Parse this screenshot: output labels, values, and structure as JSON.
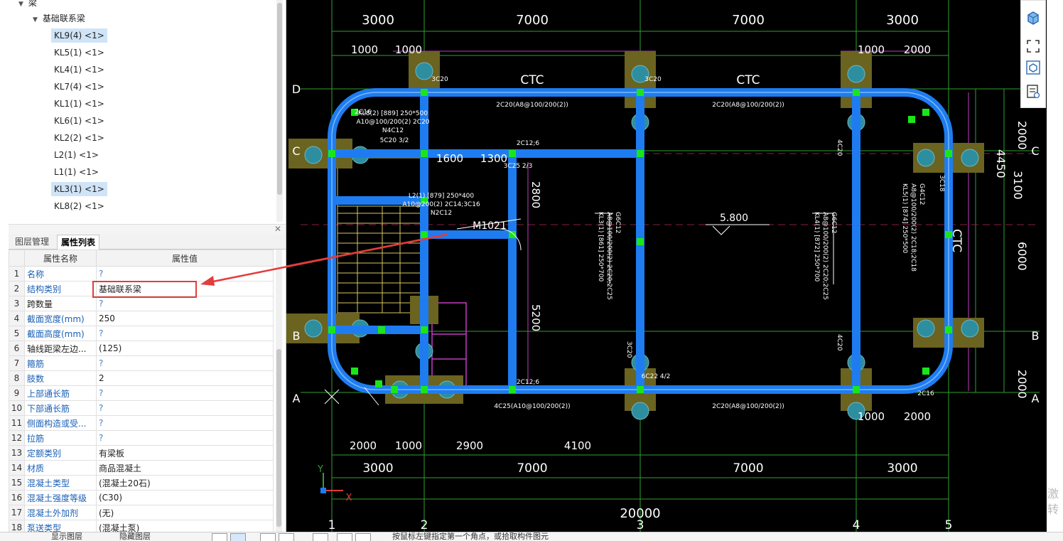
{
  "tree": {
    "root_label": "梁",
    "group_label": "基础联系梁",
    "items": [
      {
        "label": "KL9(4)",
        "count": "<1>",
        "selected": true
      },
      {
        "label": "KL5(1)",
        "count": "<1>"
      },
      {
        "label": "KL4(1)",
        "count": "<1>"
      },
      {
        "label": "KL7(4)",
        "count": "<1>"
      },
      {
        "label": "KL1(1)",
        "count": "<1>"
      },
      {
        "label": "KL6(1)",
        "count": "<1>"
      },
      {
        "label": "KL2(2)",
        "count": "<1>"
      },
      {
        "label": "L2(1)",
        "count": "<1>"
      },
      {
        "label": "L1(1)",
        "count": "<1>"
      },
      {
        "label": "KL3(1)",
        "count": "<1>",
        "selected": true
      },
      {
        "label": "KL8(2)",
        "count": "<1>"
      }
    ]
  },
  "tabs": [
    {
      "label": "图层管理"
    },
    {
      "label": "属性列表",
      "active": true
    }
  ],
  "props": {
    "header_name": "属性名称",
    "header_value": "属性值",
    "rows": [
      {
        "num": "1",
        "name": "名称",
        "value": "?",
        "blue": true
      },
      {
        "num": "2",
        "name": "结构类别",
        "value": "基础联系梁",
        "blue": true
      },
      {
        "num": "3",
        "name": "跨数量",
        "value": "?",
        "blue": false
      },
      {
        "num": "4",
        "name": "截面宽度(mm)",
        "value": "250",
        "blue": true
      },
      {
        "num": "5",
        "name": "截面高度(mm)",
        "value": "?",
        "blue": true
      },
      {
        "num": "6",
        "name": "轴线距梁左边...",
        "value": "(125)",
        "blue": false
      },
      {
        "num": "7",
        "name": "箍筋",
        "value": "?",
        "blue": true
      },
      {
        "num": "8",
        "name": "肢数",
        "value": "2",
        "blue": true
      },
      {
        "num": "9",
        "name": "上部通长筋",
        "value": "?",
        "blue": true
      },
      {
        "num": "10",
        "name": "下部通长筋",
        "value": "?",
        "blue": true
      },
      {
        "num": "11",
        "name": "侧面构造或受...",
        "value": "?",
        "blue": true
      },
      {
        "num": "12",
        "name": "拉筋",
        "value": "?",
        "blue": true
      },
      {
        "num": "13",
        "name": "定额类别",
        "value": "有梁板",
        "blue": true
      },
      {
        "num": "14",
        "name": "材质",
        "value": "商品混凝土",
        "blue": true
      },
      {
        "num": "15",
        "name": "混凝土类型",
        "value": "(混凝土20石)",
        "blue": true
      },
      {
        "num": "16",
        "name": "混凝土强度等级",
        "value": "(C30)",
        "blue": true
      },
      {
        "num": "17",
        "name": "混凝土外加剂",
        "value": "(无)",
        "blue": true
      },
      {
        "num": "18",
        "name": "泵送类型",
        "value": "(混凝土泵)",
        "blue": true
      }
    ]
  },
  "cad": {
    "top_dims_upper": [
      "3000",
      "7000",
      "7000",
      "3000"
    ],
    "top_dims_lower_left": [
      "1000",
      "1000"
    ],
    "top_dims_lower_right": [
      "1000",
      "2000"
    ],
    "bottom_dims_segments": [
      "2000",
      "1000",
      "2900",
      "4100"
    ],
    "bottom_dims_lower_right": [
      "1000",
      "2000"
    ],
    "bottom_dims_span": [
      "3000",
      "7000",
      "7000",
      "3000"
    ],
    "bottom_total": "20000",
    "axis_bottom": [
      "1",
      "2",
      "3",
      "4",
      "5"
    ],
    "axis_side": [
      "D",
      "C",
      "B",
      "A"
    ],
    "right_dims": [
      "2000",
      "4450",
      "3100",
      "6000",
      "2000"
    ],
    "inner_dims": [
      "1600",
      "1300",
      "2800",
      "5200"
    ],
    "level_mark": "5.800",
    "door_label": "M1021",
    "ctc_labels": [
      "CTC",
      "CTC",
      "CTC"
    ],
    "beam_notes": [
      "2C20(A8@100/200(2))",
      "2C20(A8@100/200(2))",
      "2C20(A8@100/200(2))",
      "4C25(A10@100/200(2))",
      "2C12;6",
      "2C12;6",
      "3C20",
      "3C20",
      "3C20",
      "6C22 4/2",
      "5C20 3/2",
      "3C25 2/3",
      "2C16",
      "2C16",
      "KL8(2) [889] 250*500",
      "A10@100/200(2) 2C20",
      "N4C12",
      "L2(1) [879] 250*400",
      "A10@200(2) 2C14;3C16",
      "N2C12",
      "KL3(1) [861] 250*700",
      "A8@100/200(2) 2C20;2C25",
      "G6C12",
      "KL4(1) [872] 250*700",
      "A8@100/200(2) 2C20;2C25",
      "G6C12",
      "KL5(1) [874] 250*500",
      "A8@100/200(2) 2C18;2C18",
      "G4C12",
      "4C20",
      "4C20",
      "3C18"
    ],
    "coord_y": "Y",
    "coord_x": "X"
  },
  "watermark": [
    "激",
    "转"
  ],
  "status": {
    "left_text": "显示图层",
    "mid_text": "隐藏图层",
    "right_text": "按鼠标左键指定第一个角点，或拾取构件图元"
  },
  "colors": {
    "canvas_bg": "#000000",
    "beam": "#1e7cf0",
    "column": "#6b6320",
    "grid": "#2fa02f",
    "highlight": "#e23c3c",
    "node": "#19e619"
  }
}
